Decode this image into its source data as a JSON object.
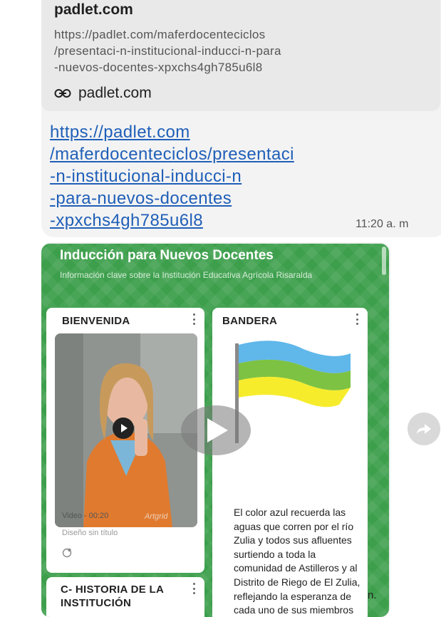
{
  "message": {
    "link_preview": {
      "domain_title": "padlet.com",
      "url_lines": [
        "https://padlet.com/maferdocenteciclos",
        "/presentaci-n-institucional-inducci-n-para",
        "-nuevos-docentes-xpxchs4gh785u6l8"
      ],
      "link_text": "padlet.com"
    },
    "link_lines": [
      "https://padlet.com",
      "/maferdocenteciclos/presentaci",
      "-n-institucional-inducci-n",
      "-para-nuevos-docentes",
      "-xpxchs4gh785u6l8"
    ],
    "time": "11:20 a. m"
  },
  "padlet": {
    "title": "Inducción para Nuevos Docentes",
    "subtitle": "Información clave sobre la Institución Educativa Agrícola Risaralda",
    "posts": [
      {
        "title": "BIENVENIDA",
        "video_meta": "Video - 00:20",
        "caption": "Diseño sin título",
        "watermark": "Artgrid"
      },
      {
        "title": "BANDERA",
        "text": "El color azul recuerda las aguas que corren por el río Zulia y todos sus afluentes surtiendo a toda la comunidad de Astilleros y al Distrito de Riego de El Zulia, reflejando la esperanza de cada uno de sus miembros por construir un"
      },
      {
        "title": "C- HISTORIA DE LA INSTITUCIÓN"
      }
    ],
    "trailing_text": "n."
  },
  "icons": {
    "link": "link-icon",
    "forward": "forward-icon",
    "play": "play-icon",
    "more": "more-vertical-icon",
    "comment": "comment-icon"
  },
  "colors": {
    "padlet_green": "#3d9f4c",
    "link_blue": "#1f5fb8",
    "bubble_gray": "#f3f3f3",
    "flag_blue": "#5fb7ea",
    "flag_green": "#7dc242",
    "flag_yellow": "#f6ec2c"
  }
}
